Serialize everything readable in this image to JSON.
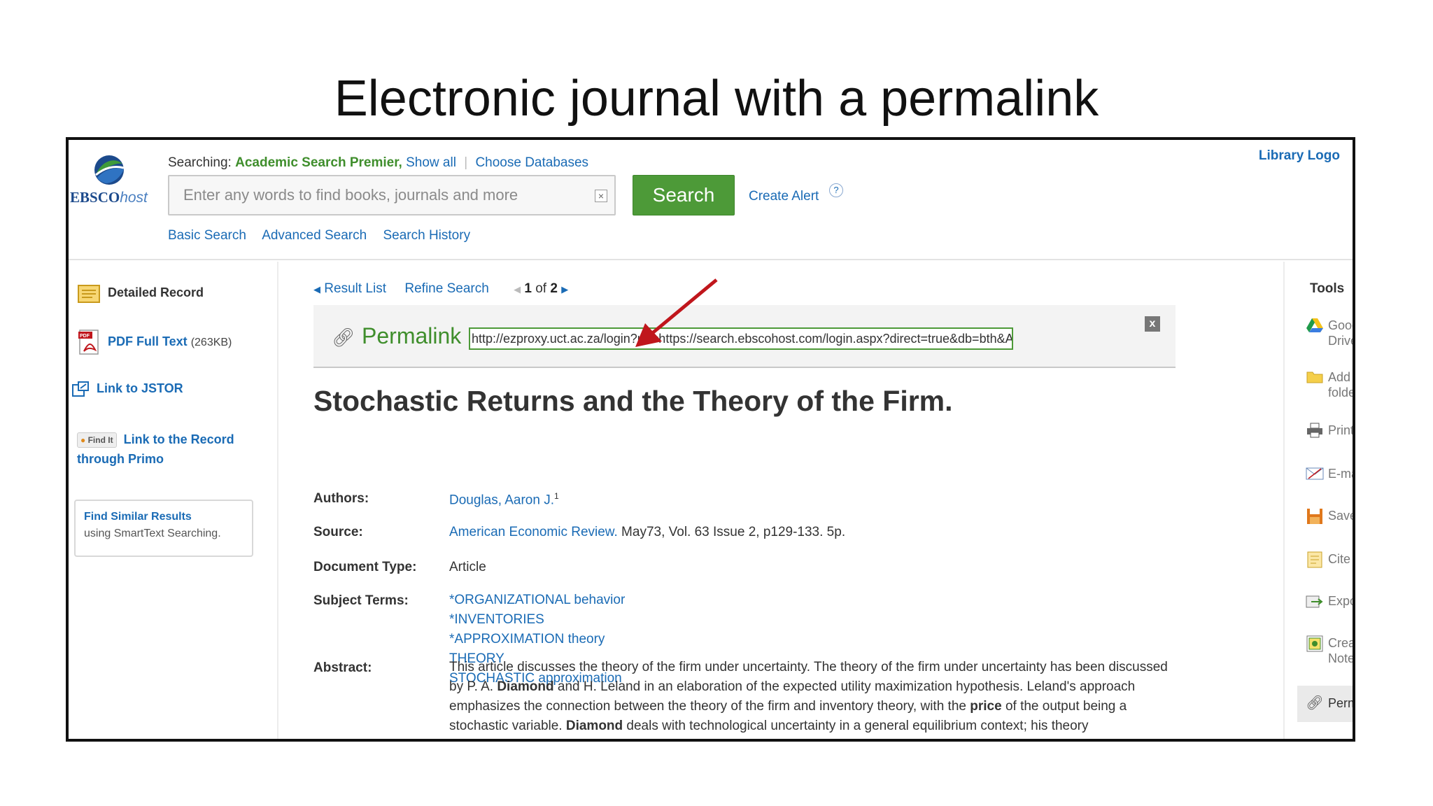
{
  "slide_title": "Electronic journal with a permalink",
  "logo": {
    "brand_main": "EBSCO",
    "brand_suffix": "host"
  },
  "library_logo": "Library Logo",
  "searching": {
    "prefix": "Searching:",
    "database": "Academic Search Premier,",
    "show_all": "Show all",
    "choose_databases": "Choose Databases"
  },
  "search": {
    "placeholder": "Enter any words to find books, journals and more",
    "button_label": "Search",
    "create_alert": "Create Alert",
    "help": "?"
  },
  "subnav": [
    "Basic Search",
    "Advanced Search",
    "Search History"
  ],
  "left_sidebar": {
    "detailed_record": "Detailed Record",
    "pdf_full_text": "PDF Full Text",
    "pdf_size": "(263KB)",
    "link_to_jstor": "Link to JSTOR",
    "find_it_badge": "Find It",
    "link_to_record_line1": "Link to the Record",
    "link_to_record_line2": "through Primo",
    "find_similar_title": "Find Similar Results",
    "find_similar_sub": "using SmartText Searching."
  },
  "result_nav": {
    "result_list": "Result List",
    "refine_search": "Refine Search",
    "current": "1",
    "of": "of",
    "total": "2"
  },
  "permalink": {
    "label": "Permalink",
    "url": "http://ezproxy.uct.ac.za/login?url=https://search.ebscohost.com/login.aspx?direct=true&db=bth&AN=",
    "close": "x"
  },
  "record": {
    "title": "Stochastic Returns and the Theory of the Firm.",
    "authors_label": "Authors:",
    "authors_value": "Douglas, Aaron J.",
    "authors_sup": "1",
    "source_label": "Source:",
    "source_journal": "American Economic Review.",
    "source_details": "May73, Vol. 63 Issue 2, p129-133. 5p.",
    "doctype_label": "Document Type:",
    "doctype_value": "Article",
    "subject_label": "Subject Terms:",
    "subject_terms": [
      "*ORGANIZATIONAL behavior",
      "*INVENTORIES",
      "*APPROXIMATION theory",
      "THEORY",
      "STOCHASTIC approximation"
    ],
    "abstract_label": "Abstract:",
    "abstract_p1": "This article discusses the theory of the firm under uncertainty. The theory of the firm under uncertainty has been discussed by P. A. ",
    "abstract_b1": "Diamond",
    "abstract_p2": " and H. Leland in an elaboration of the expected utility maximization hypothesis. Leland's approach emphasizes the connection between the theory of the firm and inventory theory, with the ",
    "abstract_b2": "price",
    "abstract_p3": " of the output being a stochastic variable. ",
    "abstract_b3": "Diamond",
    "abstract_p4": " deals with technological uncertainty in a general equilibrium context; his theory"
  },
  "tools": {
    "title": "Tools",
    "items": [
      {
        "label_1": "Google",
        "label_2": "Drive",
        "icon": "google-drive-icon"
      },
      {
        "label_1": "Add to",
        "label_2": "folder",
        "icon": "folder-icon"
      },
      {
        "label_1": "Print",
        "label_2": "",
        "icon": "printer-icon"
      },
      {
        "label_1": "E-mail",
        "label_2": "",
        "icon": "email-icon"
      },
      {
        "label_1": "Save",
        "label_2": "",
        "icon": "save-icon"
      },
      {
        "label_1": "Cite",
        "label_2": "",
        "icon": "cite-icon"
      },
      {
        "label_1": "Export",
        "label_2": "",
        "icon": "export-icon"
      },
      {
        "label_1": "Create",
        "label_2": "Note",
        "icon": "note-icon"
      },
      {
        "label_1": "Permalink",
        "label_2": "",
        "icon": "permalink-icon"
      }
    ]
  },
  "colors": {
    "accent_green": "#4d9a38",
    "link_blue": "#1a6bb5",
    "annotation_red": "#c0161c"
  }
}
